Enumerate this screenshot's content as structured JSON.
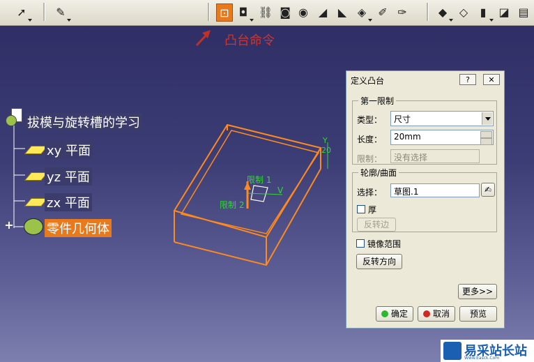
{
  "annotation": {
    "label": "凸台命令"
  },
  "tree": {
    "root": "拔模与旋转槽的学习",
    "items": [
      {
        "label": "xy 平面"
      },
      {
        "label": "yz 平面"
      },
      {
        "label": "zx 平面"
      }
    ],
    "selected": "零件几何体"
  },
  "viewport": {
    "limit1": "限制 1",
    "limit2": "限制 2",
    "dim": "20",
    "axis_v": "V",
    "axis_y": "Y"
  },
  "dialog": {
    "title": "定义凸台",
    "help": "?",
    "close": "✕",
    "first_limit": {
      "title": "第一限制",
      "type_label": "类型：",
      "type_value": "尺寸",
      "length_label": "长度：",
      "length_value": "20mm",
      "limit_label": "限制：",
      "limit_value": "没有选择"
    },
    "profile": {
      "title": "轮廓/曲面",
      "select_label": "选择：",
      "select_value": "草图.1",
      "thick_label": "厚",
      "reverse_side": "反转边"
    },
    "mirror_label": "镜像范围",
    "reverse_dir": "反转方向",
    "more": "更多>>",
    "ok": "确定",
    "cancel": "取消",
    "preview": "预览"
  },
  "watermark": {
    "text": "易采站长站",
    "sub": "Www.Easck.Com"
  },
  "colors": {
    "accent_orange": "#e87a1c",
    "selection_green": "#36d43a",
    "annotation_red": "#d0342c"
  }
}
